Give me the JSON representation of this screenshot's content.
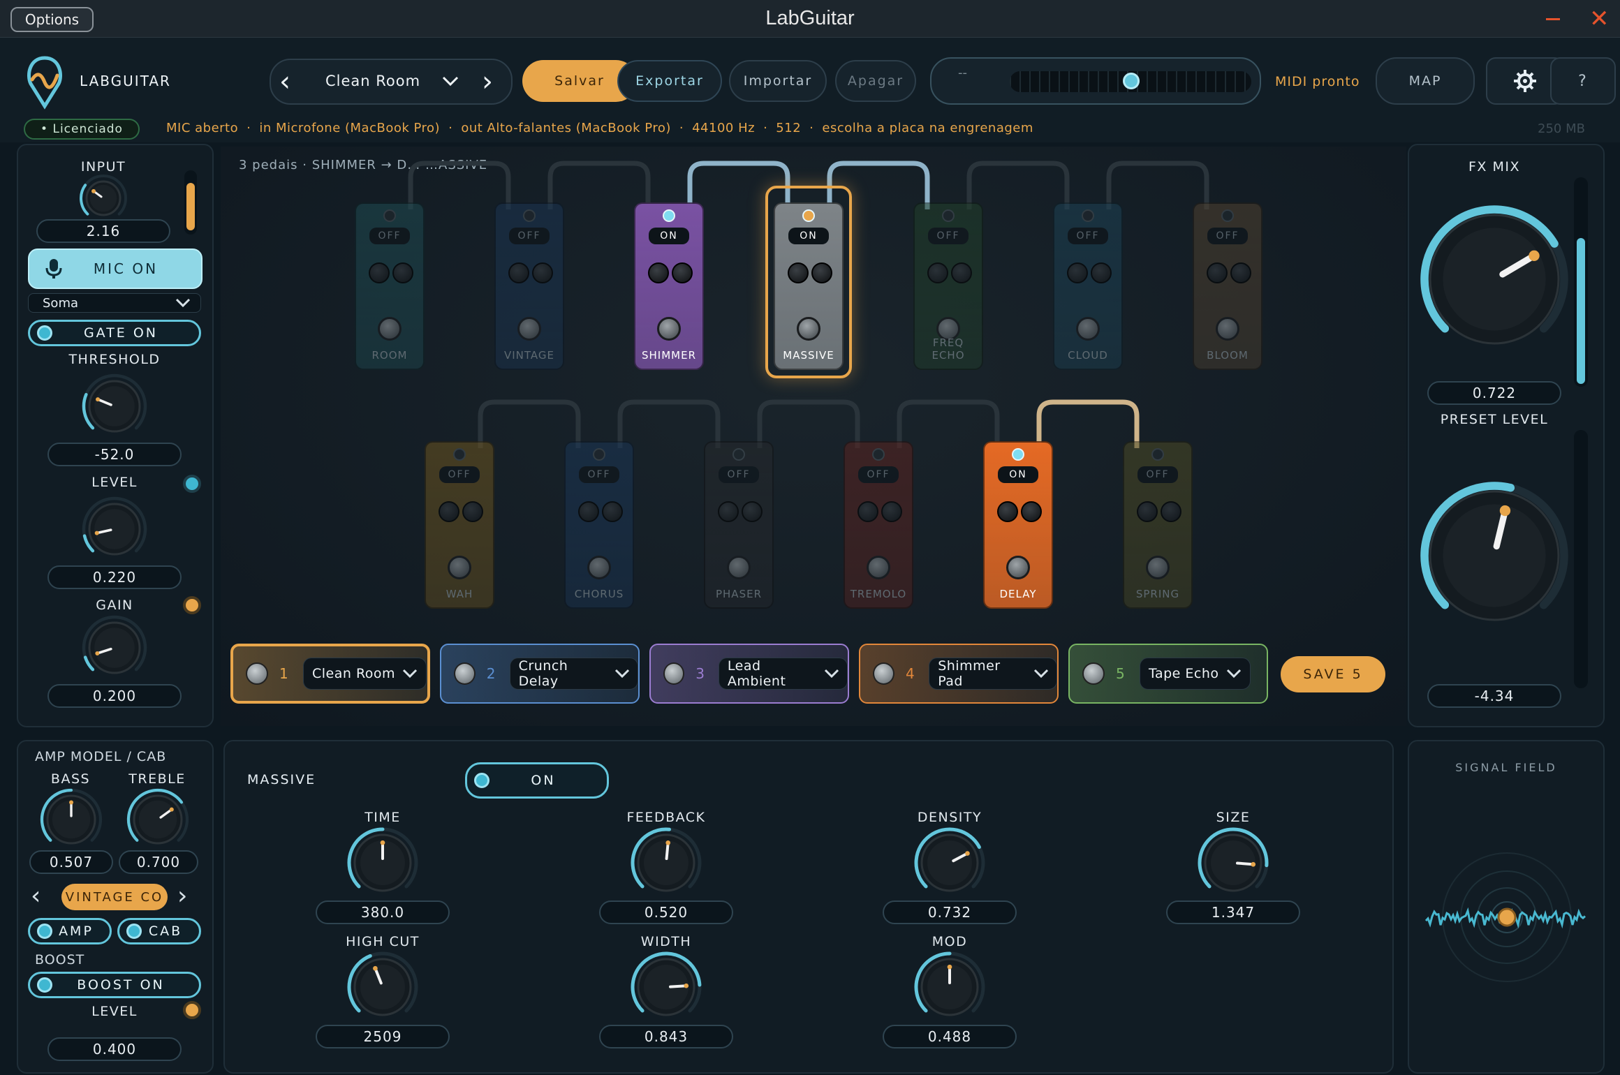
{
  "window": {
    "options_label": "Options",
    "title": "LabGuitar",
    "close_glyph": "✕"
  },
  "brand": {
    "name": "LABGUITAR",
    "license": "• Licenciado"
  },
  "preset_nav": {
    "current": "Clean Room"
  },
  "actions": {
    "save": "Salvar",
    "export": "Exportar",
    "import": "Importar",
    "delete": "Apagar"
  },
  "midi": {
    "display": "--",
    "status": "MIDI pronto",
    "map": "MAP",
    "help": "?"
  },
  "status": {
    "mic": "MIC aberto",
    "input": "in Microfone (MacBook Pro)",
    "output": "out Alto-falantes (MacBook Pro)",
    "rate": "44100 Hz",
    "buffer": "512",
    "hint": "escolha a placa na engrenagem",
    "memory": "250 MB",
    "sep": "·"
  },
  "input_panel": {
    "input_label": "INPUT",
    "input_value": "2.16",
    "mic_button": "MIC ON",
    "mode": "Soma",
    "gate": "GATE ON",
    "threshold_label": "THRESHOLD",
    "threshold_value": "-52.0",
    "level_label": "LEVEL",
    "level_value": "0.220",
    "gain_label": "GAIN",
    "gain_value": "0.200"
  },
  "chain": {
    "count": "3 pedais",
    "path": "SHIMMER → D…   …ASSIVE"
  },
  "pedals_row1": [
    {
      "name": "ROOM",
      "state": "OFF",
      "color": "#1f4b52"
    },
    {
      "name": "VINTAGE",
      "state": "OFF",
      "color": "#1b3552"
    },
    {
      "name": "SHIMMER",
      "state": "ON",
      "color": "#7a52a3"
    },
    {
      "name": "MASSIVE",
      "state": "ON",
      "color": "#7e8488"
    },
    {
      "name": "FREQ ECHO",
      "state": "OFF",
      "color": "#21402b"
    },
    {
      "name": "CLOUD",
      "state": "OFF",
      "color": "#1d4255"
    },
    {
      "name": "BLOOM",
      "state": "OFF",
      "color": "#4f4130"
    }
  ],
  "pedals_row2": [
    {
      "name": "WAH",
      "state": "OFF",
      "color": "#6b5420"
    },
    {
      "name": "CHORUS",
      "state": "OFF",
      "color": "#1b3656"
    },
    {
      "name": "PHASER",
      "state": "OFF",
      "color": "#26292d"
    },
    {
      "name": "TREMOLO",
      "state": "OFF",
      "color": "#5a2420"
    },
    {
      "name": "DELAY",
      "state": "ON",
      "color": "#e56a25"
    },
    {
      "name": "SPRING",
      "state": "OFF",
      "color": "#4c4a25"
    }
  ],
  "presets": [
    {
      "num": "1",
      "name": "Clean Room",
      "color": "#e8a64b"
    },
    {
      "num": "2",
      "name": "Crunch Delay",
      "color": "#5b8fd1"
    },
    {
      "num": "3",
      "name": "Lead Ambient",
      "color": "#9b7dd1"
    },
    {
      "num": "4",
      "name": "Shimmer Pad",
      "color": "#e2873a"
    },
    {
      "num": "5",
      "name": "Tape Echo",
      "color": "#79b563"
    }
  ],
  "save_slot": "SAVE 5",
  "fx_panel": {
    "title": "FX MIX",
    "mix_value": "0.722",
    "preset_level_label": "PRESET LEVEL",
    "level_value": "-4.34",
    "mix": 0.72
  },
  "amp_panel": {
    "title": "AMP MODEL / CAB",
    "bass_label": "BASS",
    "bass_value": "0.507",
    "treble_label": "TREBLE",
    "treble_value": "0.700",
    "model": "VINTAGE CO",
    "amp": "AMP",
    "cab": "CAB",
    "boost_label": "BOOST",
    "boost_button": "BOOST ON",
    "level_label": "LEVEL",
    "level_value": "0.400"
  },
  "effect_panel": {
    "title": "MASSIVE",
    "toggle": "ON",
    "params": [
      {
        "label": "TIME",
        "value": "380.0"
      },
      {
        "label": "FEEDBACK",
        "value": "0.520"
      },
      {
        "label": "DENSITY",
        "value": "0.732"
      },
      {
        "label": "SIZE",
        "value": "1.347"
      },
      {
        "label": "HIGH CUT",
        "value": "2509"
      },
      {
        "label": "WIDTH",
        "value": "0.843"
      },
      {
        "label": "MOD",
        "value": "0.488"
      }
    ]
  },
  "signal_field": {
    "title": "SIGNAL FIELD"
  },
  "colors": {
    "accent": "#63c6dc",
    "orange": "#e8a64b",
    "bg": "#0d1820"
  }
}
